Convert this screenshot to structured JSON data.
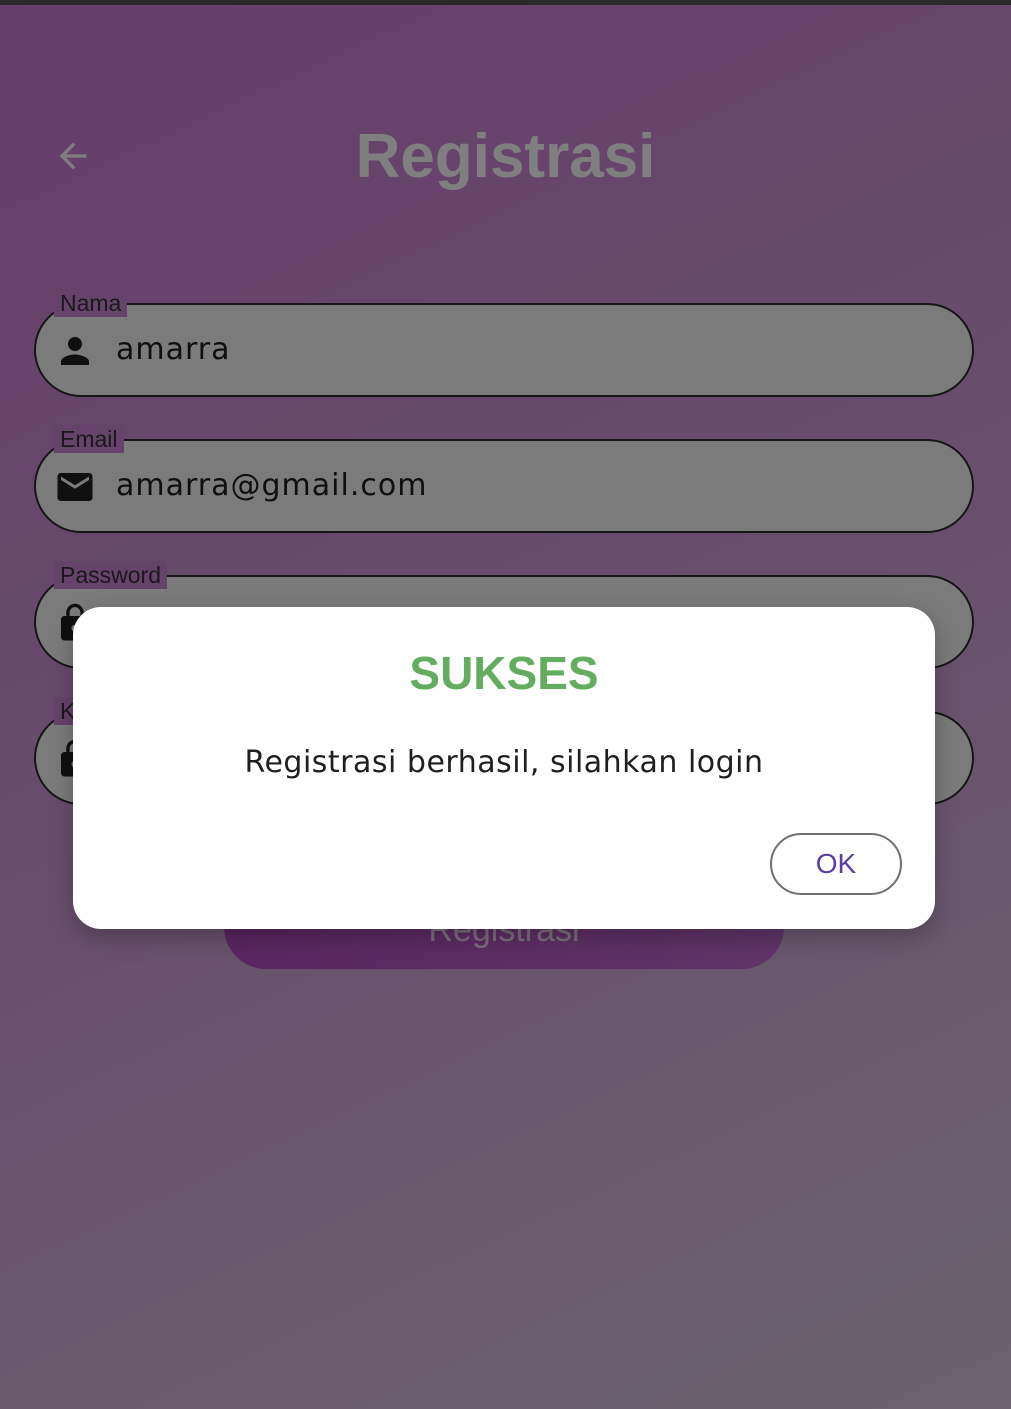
{
  "header": {
    "title": "Registrasi",
    "back_icon": "arrow-back-icon"
  },
  "form": {
    "fields": [
      {
        "label": "Nama",
        "value": "amarra",
        "icon": "person-icon"
      },
      {
        "label": "Email",
        "value": "amarra@gmail.com",
        "icon": "mail-icon"
      },
      {
        "label": "Password",
        "value": "",
        "icon": "lock-icon"
      },
      {
        "label": "K",
        "value": "",
        "icon": "lock-icon"
      }
    ],
    "submit_label": "Registrasi"
  },
  "dialog": {
    "title": "SUKSES",
    "message": "Registrasi berhasil, silahkan login",
    "ok_label": "OK"
  },
  "colors": {
    "background_gradient_start": "#cd79d6",
    "background_gradient_end": "#d7c6de",
    "dialog_title": "#64ad60",
    "ok_label": "#5c3fa0",
    "submit_button": "#b44ac2"
  }
}
